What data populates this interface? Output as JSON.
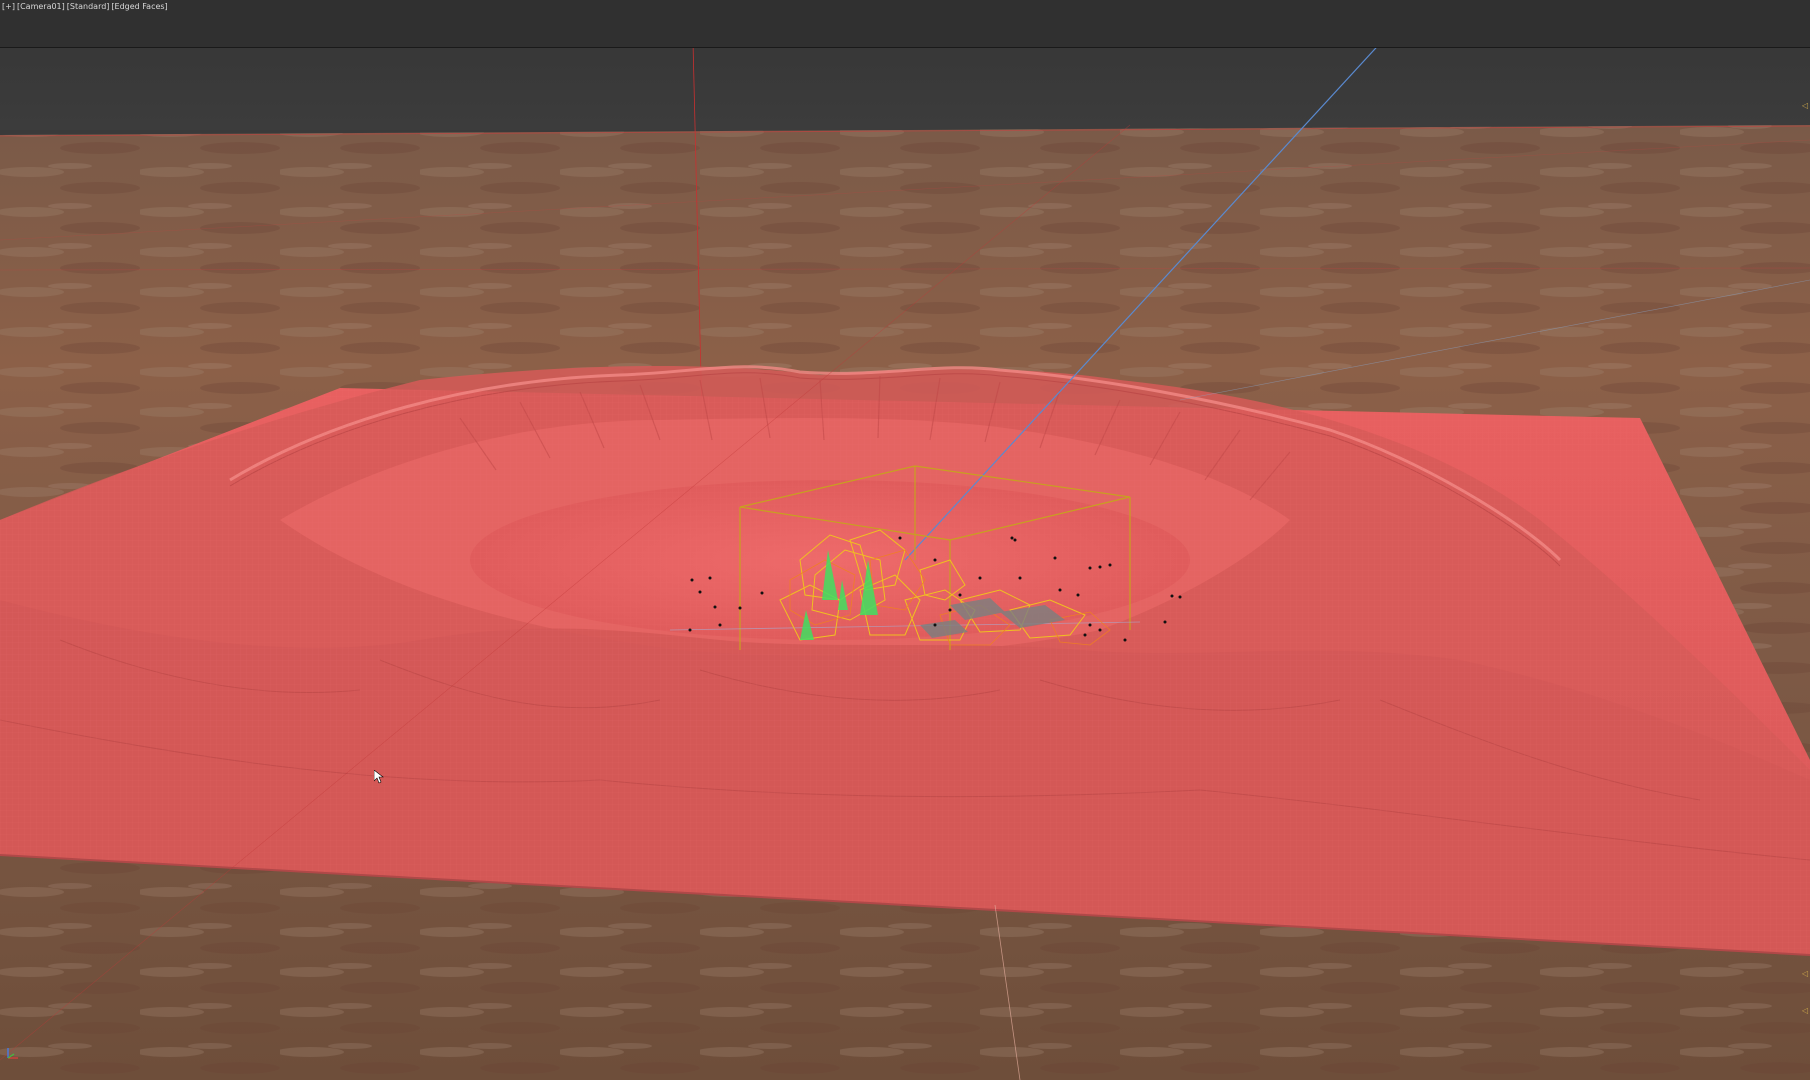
{
  "viewport": {
    "labels": [
      "[+]",
      "[Camera01]",
      "[Standard]",
      "[Edged Faces]"
    ]
  },
  "scene": {
    "description_icons": {
      "cursor": "mouse-pointer-icon",
      "axis": "axis-tripod-icon"
    },
    "colors": {
      "terrain_selected": "#e85a5a",
      "ground_texture": "#8a5a40",
      "gizmo_bbox": "#c8a020",
      "particles_yellow": "#f0d020",
      "particles_green": "#40e060",
      "camera_line": "#5a8ad0",
      "grid_red": "#c83030",
      "viewport_bg": "#3a3a3a"
    }
  }
}
